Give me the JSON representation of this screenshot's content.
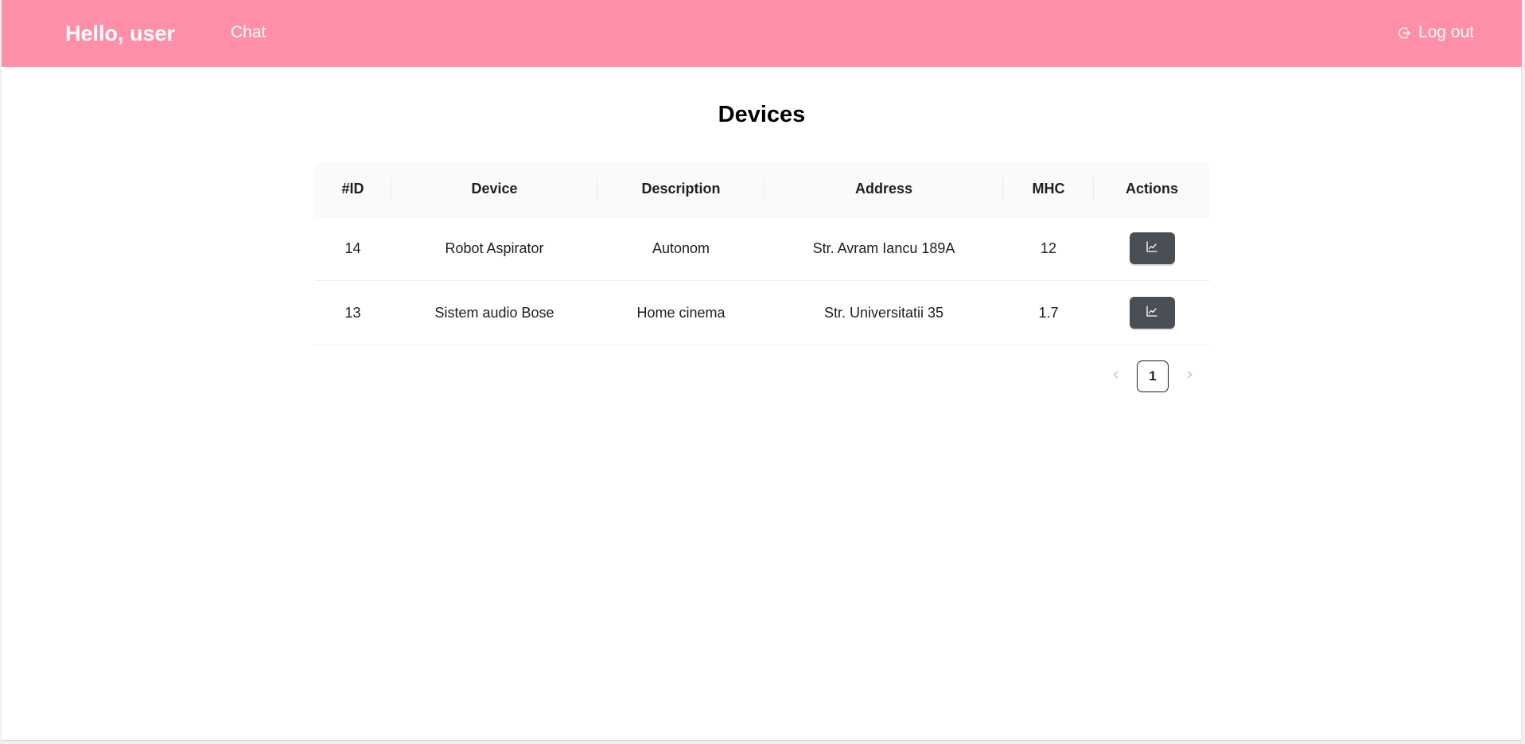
{
  "header": {
    "greeting": "Hello, user",
    "nav_chat": "Chat",
    "logout_label": "Log out",
    "background_color": "#ff8fa9"
  },
  "page": {
    "title": "Devices"
  },
  "table": {
    "columns": [
      "#ID",
      "Device",
      "Description",
      "Address",
      "MHC",
      "Actions"
    ],
    "rows": [
      {
        "id": "14",
        "device": "Robot Aspirator",
        "description": "Autonom",
        "address": "Str. Avram Iancu 189A",
        "mhc": "12",
        "action_icon": "line-chart-icon"
      },
      {
        "id": "13",
        "device": "Sistem audio Bose",
        "description": "Home cinema",
        "address": "Str. Universitatii 35",
        "mhc": "1.7",
        "action_icon": "line-chart-icon"
      }
    ],
    "action_button_color": "#4a4f57"
  },
  "pagination": {
    "current_page": "1",
    "prev_icon": "chevron-left-icon",
    "next_icon": "chevron-right-icon"
  }
}
